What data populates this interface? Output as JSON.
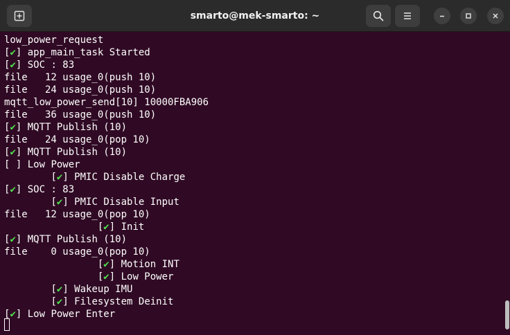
{
  "window": {
    "title": "smarto@mek-smarto: ~"
  },
  "icons": {
    "new_tab": "new-tab-icon",
    "search": "search-icon",
    "menu": "hamburger-menu-icon",
    "minimize": "minimize-icon",
    "maximize": "maximize-icon",
    "close": "close-icon"
  },
  "colors": {
    "terminal_bg": "#300a24",
    "titlebar_bg": "#2b2b2b",
    "check_mark": "#4ee44e",
    "text": "#ffffff"
  },
  "terminal": {
    "lines": [
      {
        "prefix": "",
        "status": "",
        "text": "low_power_request"
      },
      {
        "prefix": "",
        "status": "check",
        "text": "app_main_task Started"
      },
      {
        "prefix": "",
        "status": "check",
        "text": "SOC : 83"
      },
      {
        "prefix": "",
        "status": "",
        "text": "file   12 usage_0(push 10)"
      },
      {
        "prefix": "",
        "status": "",
        "text": "file   24 usage_0(push 10)"
      },
      {
        "prefix": "",
        "status": "",
        "text": "mqtt_low_power_send[10] 10000FBA906"
      },
      {
        "prefix": "",
        "status": "",
        "text": "file   36 usage_0(push 10)"
      },
      {
        "prefix": "",
        "status": "check",
        "text": "MQTT Publish (10)"
      },
      {
        "prefix": "",
        "status": "",
        "text": "file   24 usage_0(pop 10)"
      },
      {
        "prefix": "",
        "status": "check",
        "text": "MQTT Publish (10)"
      },
      {
        "prefix": "",
        "status": "empty",
        "text": "Low Power"
      },
      {
        "prefix": "        ",
        "status": "check",
        "text": "PMIC Disable Charge"
      },
      {
        "prefix": "",
        "status": "check",
        "text": "SOC : 83"
      },
      {
        "prefix": "        ",
        "status": "check",
        "text": "PMIC Disable Input"
      },
      {
        "prefix": "",
        "status": "",
        "text": "file   12 usage_0(pop 10)"
      },
      {
        "prefix": "                ",
        "status": "check",
        "text": "Init"
      },
      {
        "prefix": "",
        "status": "check",
        "text": "MQTT Publish (10)"
      },
      {
        "prefix": "",
        "status": "",
        "text": "file    0 usage_0(pop 10)"
      },
      {
        "prefix": "                ",
        "status": "check",
        "text": "Motion INT"
      },
      {
        "prefix": "                ",
        "status": "check",
        "text": "Low Power"
      },
      {
        "prefix": "        ",
        "status": "check",
        "text": "Wakeup IMU"
      },
      {
        "prefix": "        ",
        "status": "check",
        "text": "Filesystem Deinit"
      },
      {
        "prefix": "",
        "status": "check",
        "text": "Low Power Enter"
      }
    ]
  }
}
